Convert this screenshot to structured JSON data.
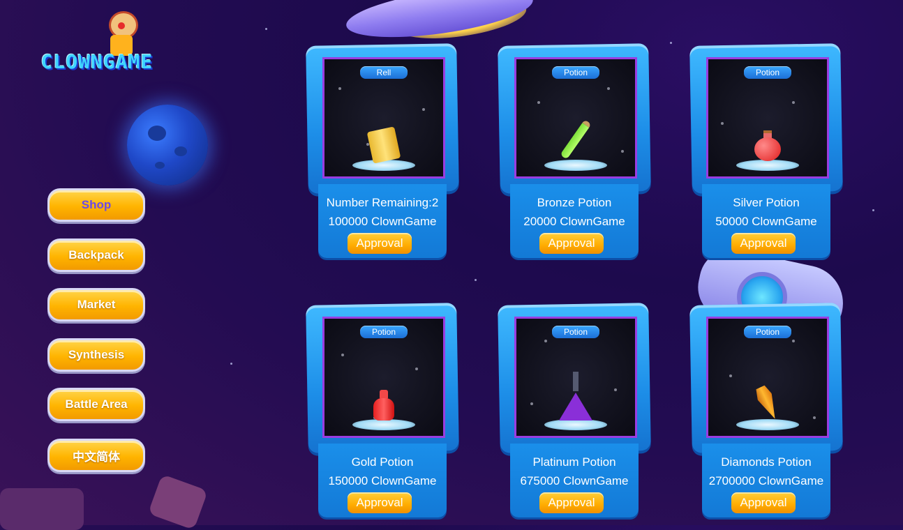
{
  "logo": {
    "text": "CLOWNGAME"
  },
  "menu": {
    "items": [
      {
        "label": "Shop",
        "active": true
      },
      {
        "label": "Backpack",
        "active": false
      },
      {
        "label": "Market",
        "active": false
      },
      {
        "label": "Synthesis",
        "active": false
      },
      {
        "label": "Battle Area",
        "active": false
      },
      {
        "label": "中文简体",
        "active": false
      }
    ]
  },
  "shop": {
    "items": [
      {
        "tag": "Rell",
        "name": "Number Remaining:2",
        "price": "100000 ClownGame",
        "button": "Approval",
        "icon": "scroll-icon"
      },
      {
        "tag": "Potion",
        "name": "Bronze Potion",
        "price": "20000 ClownGame",
        "button": "Approval",
        "icon": "green-vial-icon"
      },
      {
        "tag": "Potion",
        "name": "Silver Potion",
        "price": "50000 ClownGame",
        "button": "Approval",
        "icon": "red-flask-icon"
      },
      {
        "tag": "Potion",
        "name": "Gold Potion",
        "price": "150000 ClownGame",
        "button": "Approval",
        "icon": "red-jar-icon"
      },
      {
        "tag": "Potion",
        "name": "Platinum Potion",
        "price": "675000 ClownGame",
        "button": "Approval",
        "icon": "purple-flask-icon"
      },
      {
        "tag": "Potion",
        "name": "Diamonds Potion",
        "price": "2700000 ClownGame",
        "button": "Approval",
        "icon": "orange-gem-icon"
      }
    ]
  },
  "colors": {
    "button": "#ffb400",
    "card": "#1d8ee8",
    "active_text": "#6b4ae8",
    "background": "#1d0a4d"
  }
}
